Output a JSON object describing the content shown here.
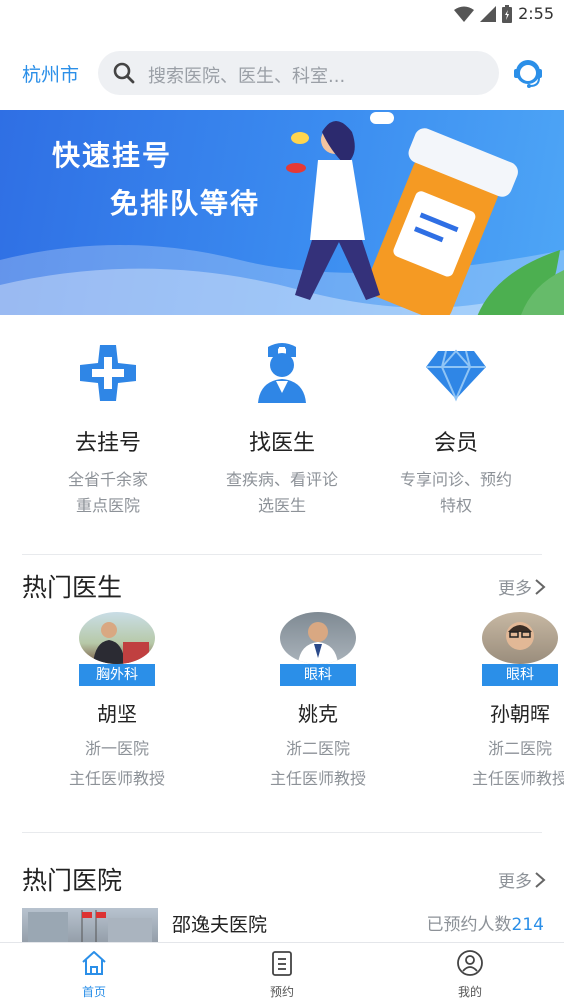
{
  "status_bar": {
    "time": "2:55"
  },
  "header": {
    "city": "杭州市",
    "search_placeholder": "搜索医院、医生、科室..."
  },
  "banner": {
    "line1": "快速挂号",
    "line2": "免排队等待"
  },
  "entries": [
    {
      "title": "去挂号",
      "sub1": "全省千余家",
      "sub2": "重点医院",
      "icon": "medical-cross-icon"
    },
    {
      "title": "找医生",
      "sub1": "查疾病、看评论",
      "sub2": "选医生",
      "icon": "nurse-icon"
    },
    {
      "title": "会员",
      "sub1": "专享问诊、预约",
      "sub2": "特权",
      "icon": "diamond-icon"
    }
  ],
  "hot_doctors": {
    "title": "热门医生",
    "more": "更多",
    "items": [
      {
        "dept": "胸外科",
        "name": "胡坚",
        "hospital": "浙一医院",
        "title": "主任医师教授"
      },
      {
        "dept": "眼科",
        "name": "姚克",
        "hospital": "浙二医院",
        "title": "主任医师教授"
      },
      {
        "dept": "眼科",
        "name": "孙朝晖",
        "hospital": "浙二医院",
        "title": "主任医师教授"
      }
    ]
  },
  "hot_hospitals": {
    "title": "热门医院",
    "more": "更多",
    "items": [
      {
        "name": "邵逸夫医院",
        "count_label": "已预约人数",
        "count": "214"
      }
    ]
  },
  "tabbar": {
    "items": [
      {
        "label": "首页",
        "icon": "home-icon",
        "active": true
      },
      {
        "label": "预约",
        "icon": "clipboard-icon",
        "active": false
      },
      {
        "label": "我的",
        "icon": "user-circle-icon",
        "active": false
      }
    ]
  },
  "colors": {
    "accent": "#2b8fe8",
    "banner": "#3b8cf0"
  }
}
